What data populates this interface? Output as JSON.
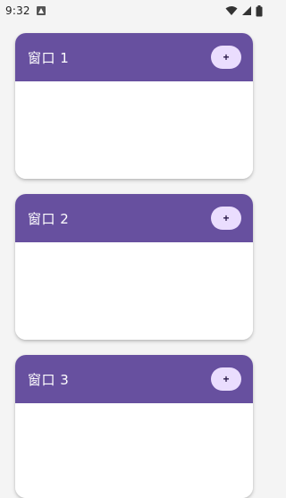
{
  "status_bar": {
    "time": "9:32",
    "notification_icon": "a-notification-icon",
    "wifi_icon": "wifi-icon",
    "signal_icon": "signal-icon",
    "battery_icon": "battery-icon"
  },
  "colors": {
    "header": "#67509f",
    "add_button_bg": "#eaddfe",
    "background": "#f4f4f4"
  },
  "cards": [
    {
      "title": "窗口 1",
      "add_label": "+"
    },
    {
      "title": "窗口 2",
      "add_label": "+"
    },
    {
      "title": "窗口 3",
      "add_label": "+"
    }
  ]
}
